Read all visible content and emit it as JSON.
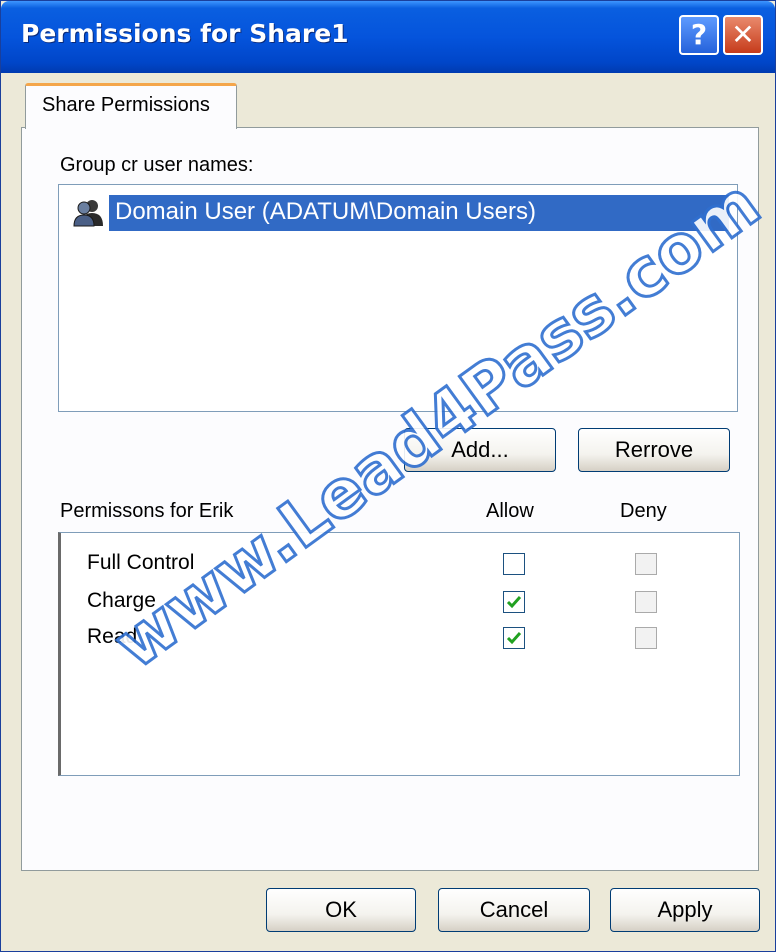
{
  "window": {
    "title": "Permissions for Share1",
    "help_label": "?",
    "close_label": "✕"
  },
  "tab": {
    "label": "Share Permissions"
  },
  "groups": {
    "label": "Group cr user names:",
    "users": [
      {
        "name": "Domain User (ADATUM\\Domain Users)",
        "selected": true,
        "icon": "group-users-icon"
      }
    ],
    "add_label": "Add...",
    "remove_label": "Rerrove"
  },
  "permissions": {
    "label": "Permissons for Erik",
    "allow_header": "Allow",
    "deny_header": "Deny",
    "rows": [
      {
        "name": "Full Control",
        "allow": false,
        "deny": false
      },
      {
        "name": "Charge",
        "allow": true,
        "deny": false
      },
      {
        "name": "Read",
        "allow": true,
        "deny": false
      }
    ]
  },
  "footer": {
    "ok_label": "OK",
    "cancel_label": "Cancel",
    "apply_label": "Apply"
  },
  "watermark": "www.Lead4Pass.com",
  "colors": {
    "titlebar": "#0554dc",
    "selection": "#316ac5",
    "tab_accent": "#f4a64b",
    "check": "#21a121"
  }
}
